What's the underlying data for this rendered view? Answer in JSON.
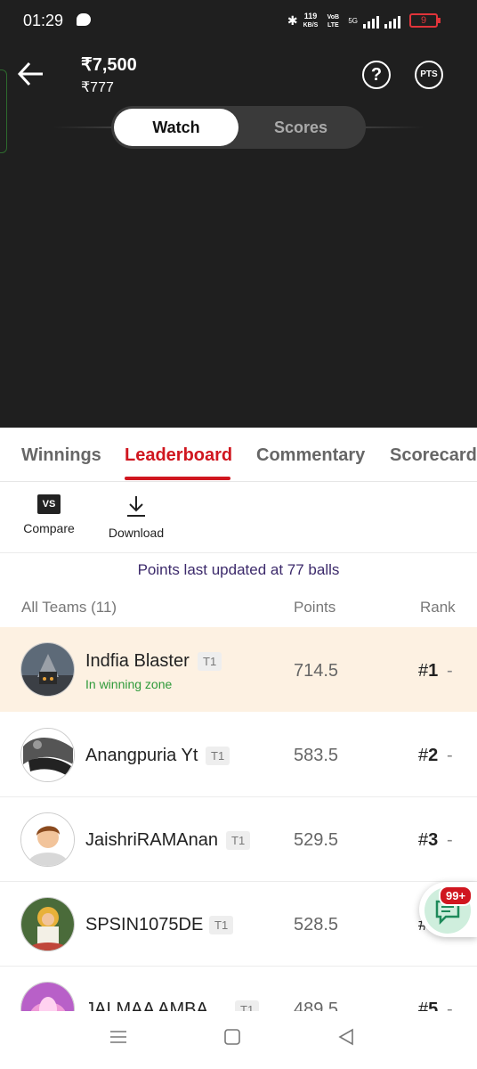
{
  "status_bar": {
    "time": "01:29",
    "speed_value": "119",
    "speed_unit": "KB/S",
    "network_label": "VoB LTE",
    "network_gen": "5G",
    "battery": "9"
  },
  "header": {
    "prize": "₹7,500",
    "entry": "₹777",
    "help_label": "?",
    "pts_label": "PTS"
  },
  "segment": {
    "watch": "Watch",
    "scores": "Scores"
  },
  "tabs": [
    "Winnings",
    "Leaderboard",
    "Commentary",
    "Scorecard"
  ],
  "tools": {
    "compare": "Compare",
    "download": "Download",
    "vs_label": "VS"
  },
  "updated_text": "Points last updated at 77 balls",
  "table_header": {
    "teams": "All Teams (11)",
    "points": "Points",
    "rank": "Rank"
  },
  "rows": [
    {
      "name": "Indfia Blaster",
      "tag": "T1",
      "zone": "In winning zone",
      "points": "714.5",
      "rank_hash": "#",
      "rank_num": "1",
      "dash": "-"
    },
    {
      "name": "Anangpuria Yt",
      "tag": "T1",
      "points": "583.5",
      "rank_hash": "#",
      "rank_num": "2",
      "dash": "-"
    },
    {
      "name": "JaishriRAMAnan",
      "tag": "T1",
      "points": "529.5",
      "rank_hash": "#",
      "rank_num": "3",
      "dash": "-"
    },
    {
      "name": "SPSIN1075DE",
      "tag": "T1",
      "points": "528.5",
      "rank_hash": "#",
      "rank_num": "4",
      "dash": "-"
    },
    {
      "name": "JAI MAA AMBA",
      "tag": "T1",
      "points": "489.5",
      "rank_hash": "#",
      "rank_num": "5",
      "dash": "-"
    }
  ],
  "chat": {
    "badge": "99+"
  },
  "colors": {
    "accent": "#d0161f",
    "highlight_row": "#fdf1e2",
    "winning_zone": "#2e9a3a",
    "dark_bg": "#1f1f1f"
  }
}
